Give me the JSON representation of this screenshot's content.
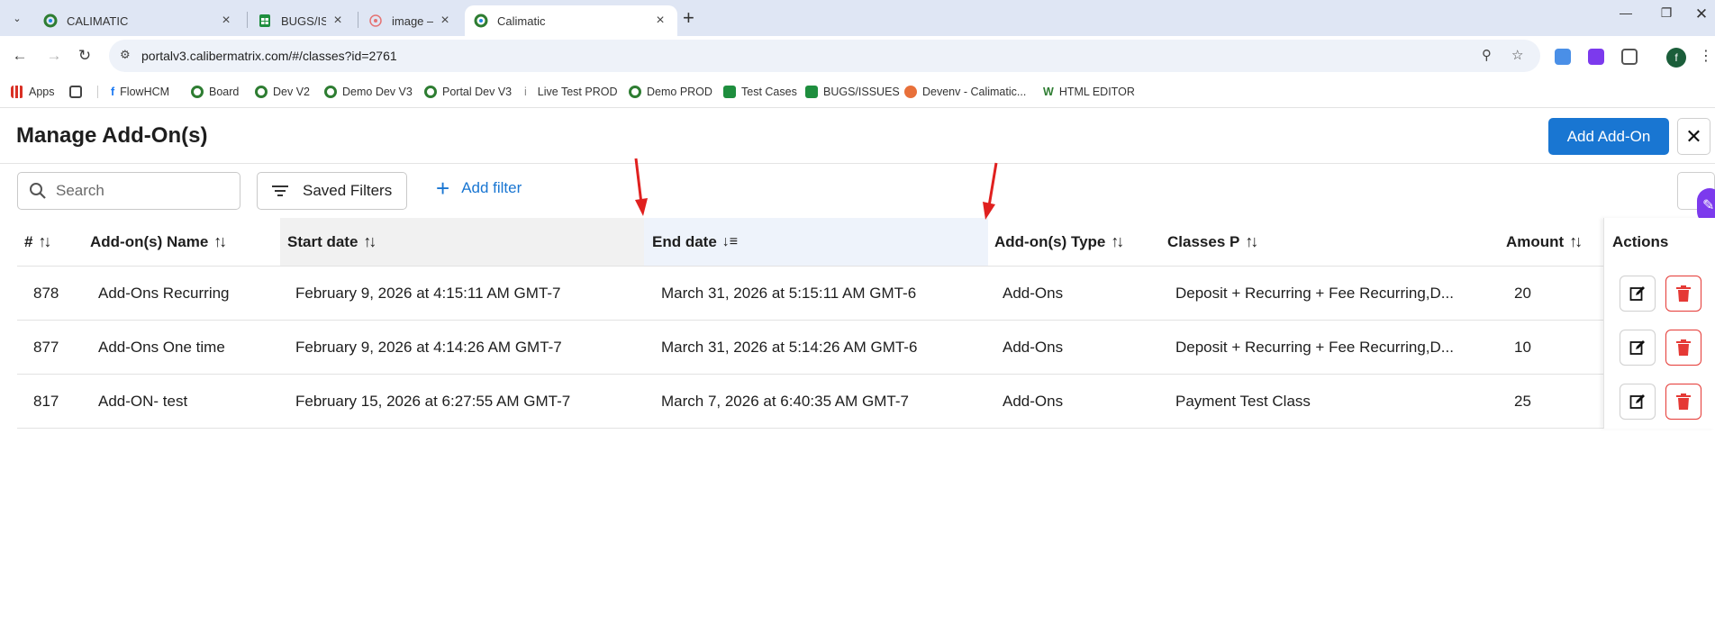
{
  "browser": {
    "tabs": [
      {
        "title": "CALIMATIC",
        "favicon": "calimatic-icon"
      },
      {
        "title": "BUGS/ISSU",
        "favicon": "sheets-icon"
      },
      {
        "title": "image —",
        "favicon": "image-icon"
      },
      {
        "title": "Calimatic",
        "favicon": "calimatic-icon"
      }
    ],
    "url": "portalv3.calibermatrix.com/#/classes?id=2761",
    "profile_initial": "f",
    "bookmarks": [
      "Apps",
      "FlowHCM",
      "Board",
      "Dev V2",
      "Demo Dev V3",
      "Portal Dev V3",
      "Live Test PROD",
      "Demo PROD",
      "Test Cases",
      "BUGS/ISSUES",
      "Devenv - Calimatic...",
      "HTML EDITOR"
    ]
  },
  "page": {
    "title": "Manage Add-On(s)",
    "add_button": "Add Add-On",
    "search_placeholder": "Search",
    "saved_filters": "Saved Filters",
    "add_filter": "Add filter"
  },
  "table": {
    "headers": {
      "id": "#",
      "name": "Add-on(s) Name",
      "start": "Start date",
      "end": "End date",
      "type": "Add-on(s) Type",
      "classes": "Classes P",
      "amount": "Amount",
      "actions": "Actions"
    },
    "rows": [
      {
        "id": "878",
        "name": "Add-Ons Recurring",
        "start": "February 9, 2026 at 4:15:11 AM GMT-7",
        "end": "March 31, 2026 at 5:15:11 AM GMT-6",
        "type": "Add-Ons",
        "classes": "Deposit + Recurring + Fee Recurring,D...",
        "amount": "20"
      },
      {
        "id": "877",
        "name": "Add-Ons One time",
        "start": "February 9, 2026 at 4:14:26 AM GMT-7",
        "end": "March 31, 2026 at 5:14:26 AM GMT-6",
        "type": "Add-Ons",
        "classes": "Deposit + Recurring + Fee Recurring,D...",
        "amount": "10"
      },
      {
        "id": "817",
        "name": "Add-ON- test",
        "start": "February 15, 2026 at 6:27:55 AM GMT-7",
        "end": "March 7, 2026 at 6:40:35 AM GMT-7",
        "type": "Add-Ons",
        "classes": "Payment Test Class",
        "amount": "25"
      }
    ]
  },
  "colors": {
    "primary": "#1976d2",
    "danger": "#e53935",
    "annotation": "#e0201f"
  }
}
